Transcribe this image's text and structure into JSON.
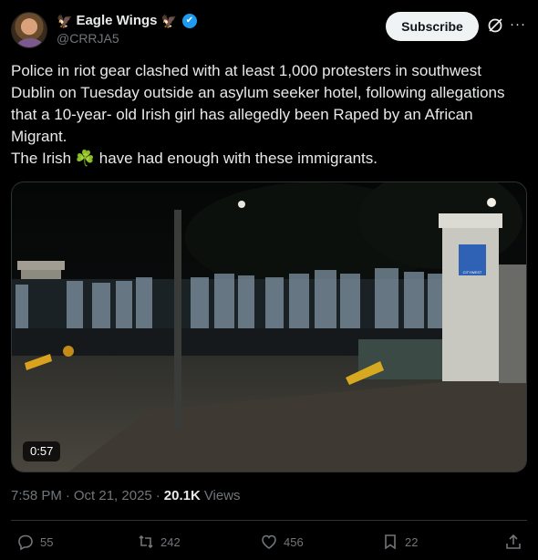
{
  "author": {
    "name": "Eagle Wings",
    "handle": "@CRRJA5",
    "verified_mark": "✔",
    "name_emoji": "🦅"
  },
  "header": {
    "subscribe_label": "Subscribe",
    "grok_icon": "grok-icon",
    "more_icon": "more-icon",
    "more_glyph": "···"
  },
  "post": {
    "text": "Police in riot gear clashed with at least 1,000 protesters in southwest Dublin on Tuesday outside an asylum seeker hotel, following allegations that a 10-year- old Irish girl has allegedly been Raped by an African Migrant.\nThe Irish ☘️ have had enough with these immigrants."
  },
  "media": {
    "duration": "0:57",
    "sign_text": "CITYWEST"
  },
  "meta": {
    "time": "7:58 PM",
    "separator": "·",
    "date": "Oct 21, 2025",
    "views_count": "20.1K",
    "views_label": "Views"
  },
  "actions": {
    "replies": "55",
    "reposts": "242",
    "likes": "456",
    "bookmarks": "22"
  },
  "colors": {
    "background": "#000000",
    "text": "#e7e9ea",
    "muted": "#71767b",
    "verified": "#1d9bf0",
    "divider": "#2f3336"
  }
}
